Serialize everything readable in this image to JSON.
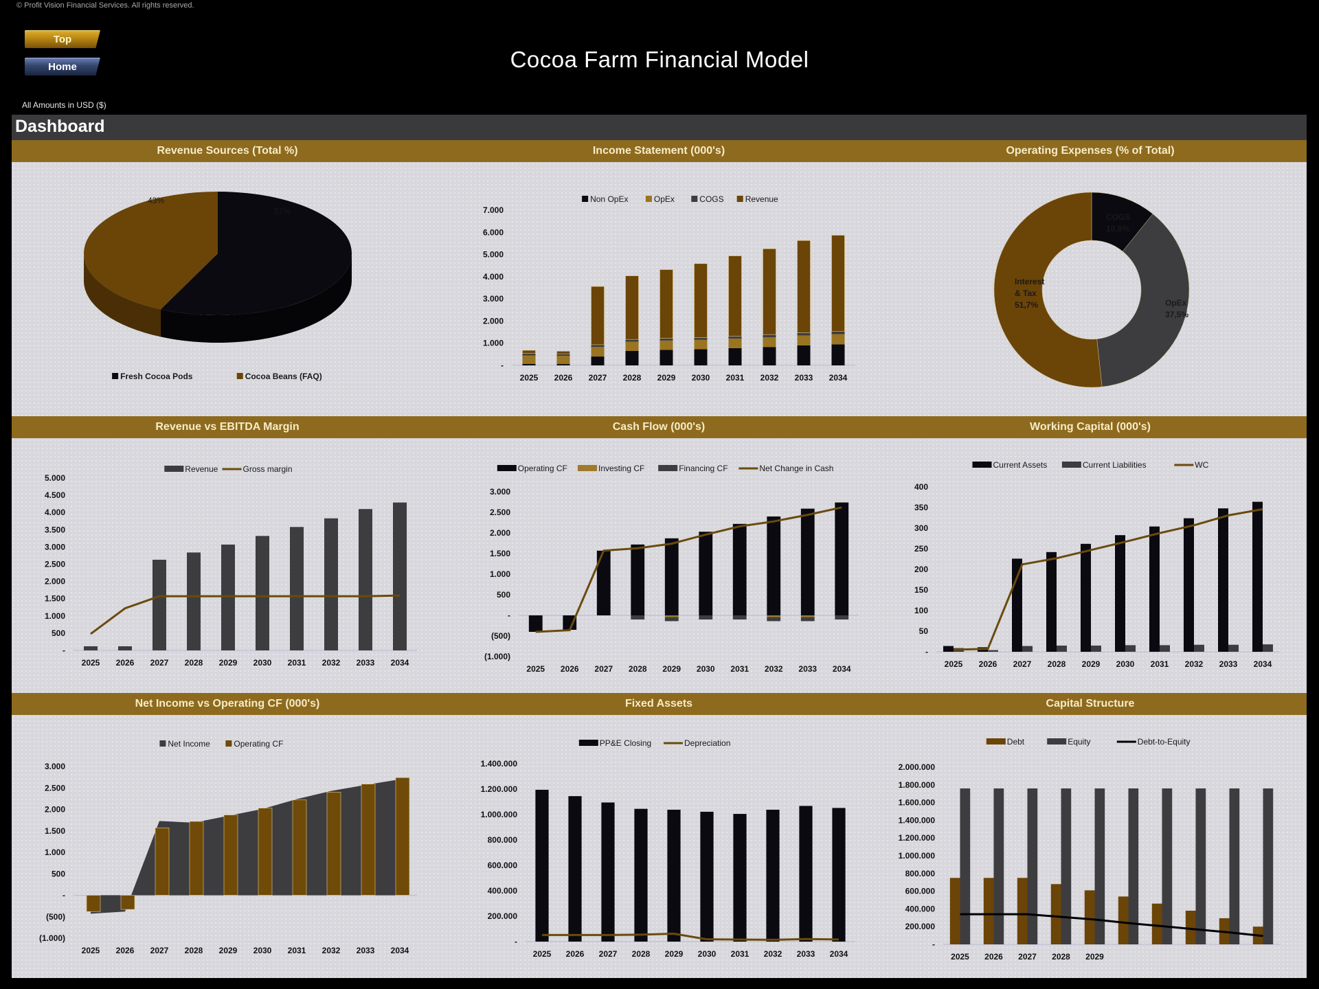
{
  "header": {
    "copyright": "© Profit Vision Financial Services. All rights reserved.",
    "title": "Cocoa Farm Financial Model",
    "amounts_note": "All Amounts in  USD ($)",
    "nav": {
      "top_label": "Top",
      "home_label": "Home"
    },
    "dashboard_label": "Dashboard"
  },
  "colors": {
    "gold_band": "#8e6a1e",
    "brown": "#6b4408",
    "dark": "#0a0a10",
    "gray": "#3d3d40",
    "tan": "#9a7420",
    "panel": "#d7d7dc"
  },
  "sections": {
    "row1": [
      "Revenue Sources (Total %)",
      "Income Statement (000's)",
      "Operating Expenses (% of Total)"
    ],
    "row2": [
      "Revenue vs EBITDA Margin",
      "Cash Flow (000's)",
      "Working Capital (000's)"
    ],
    "row3": [
      "Net Income vs Operating CF (000's)",
      "Fixed Assets",
      "Capital Structure"
    ]
  },
  "chart_data": [
    {
      "id": "revenue_sources",
      "type": "pie",
      "title": "Revenue Sources (Total %)",
      "labels": [
        "Fresh Cocoa Pods",
        "Cocoa Beans (FAQ)"
      ],
      "values": [
        57,
        43
      ],
      "value_labels": [
        "57%",
        "43%"
      ],
      "legend": "bottom"
    },
    {
      "id": "income_statement",
      "type": "bar",
      "stacked": true,
      "title": "Income Statement (000's)",
      "categories": [
        "2025",
        "2026",
        "2027",
        "2028",
        "2029",
        "2030",
        "2031",
        "2032",
        "2033",
        "2034"
      ],
      "series": [
        {
          "name": "Non OpEx",
          "values": [
            70,
            60,
            400,
            650,
            700,
            730,
            780,
            830,
            900,
            950
          ]
        },
        {
          "name": "OpEx",
          "values": [
            380,
            370,
            430,
            420,
            420,
            420,
            430,
            440,
            450,
            460
          ]
        },
        {
          "name": "COGS",
          "values": [
            90,
            90,
            100,
            100,
            100,
            100,
            110,
            120,
            120,
            130
          ]
        },
        {
          "name": "Revenue",
          "values": [
            140,
            120,
            2630,
            2870,
            3100,
            3340,
            3620,
            3870,
            4160,
            4330
          ]
        }
      ],
      "ylim": [
        0,
        7000
      ],
      "yticks": [
        "-",
        "1.000",
        "2.000",
        "3.000",
        "4.000",
        "5.000",
        "6.000",
        "7.000"
      ],
      "legend": "top"
    },
    {
      "id": "operating_expenses",
      "type": "pie",
      "donut": true,
      "title": "Operating Expenses (% of Total)",
      "labels": [
        "COGS",
        "OpEx",
        "Interest & Tax"
      ],
      "values": [
        10.8,
        37.5,
        51.7
      ],
      "value_labels": [
        "10,8%",
        "37,5%",
        "51,7%"
      ],
      "label_lines": [
        [
          "COGS",
          "10,8%"
        ],
        [
          "OpEx",
          "37,5%"
        ],
        [
          "Interest",
          "& Tax",
          "51,7%"
        ]
      ]
    },
    {
      "id": "revenue_vs_ebitda",
      "type": "bar",
      "title": "Revenue vs EBITDA Margin",
      "categories": [
        "2025",
        "2026",
        "2027",
        "2028",
        "2029",
        "2030",
        "2031",
        "2032",
        "2033",
        "2034"
      ],
      "series": [
        {
          "name": "Revenue",
          "kind": "bar",
          "values": [
            120,
            120,
            2630,
            2840,
            3070,
            3320,
            3580,
            3830,
            4100,
            4290
          ]
        },
        {
          "name": "Gross margin",
          "kind": "line",
          "values": [
            480,
            1220,
            1570,
            1570,
            1570,
            1570,
            1570,
            1570,
            1570,
            1590
          ]
        }
      ],
      "ylim": [
        0,
        5000
      ],
      "yticks": [
        "-",
        "500",
        "1.000",
        "1.500",
        "2.000",
        "2.500",
        "3.000",
        "3.500",
        "4.000",
        "4.500",
        "5.000"
      ],
      "legend": "top"
    },
    {
      "id": "cash_flow",
      "type": "bar",
      "stacked": true,
      "title": "Cash Flow (000's)",
      "categories": [
        "2025",
        "2026",
        "2027",
        "2028",
        "2029",
        "2030",
        "2031",
        "2032",
        "2033",
        "2034"
      ],
      "series": [
        {
          "name": "Operating CF",
          "kind": "bar",
          "values": [
            -400,
            -350,
            1570,
            1720,
            1870,
            2030,
            2220,
            2400,
            2590,
            2740
          ]
        },
        {
          "name": "Investing CF",
          "kind": "bar",
          "values": [
            0,
            0,
            0,
            0,
            -40,
            0,
            0,
            -40,
            -40,
            0
          ]
        },
        {
          "name": "Financing CF",
          "kind": "bar",
          "values": [
            0,
            0,
            0,
            -100,
            -100,
            -100,
            -100,
            -100,
            -100,
            -100
          ]
        },
        {
          "name": "Net Change in Cash",
          "kind": "line",
          "values": [
            -400,
            -360,
            1570,
            1630,
            1740,
            1960,
            2160,
            2280,
            2440,
            2620
          ]
        }
      ],
      "ylim": [
        -1000,
        3000
      ],
      "yticks": [
        "(1.000)",
        "(500)",
        "-",
        "500",
        "1.000",
        "1.500",
        "2.000",
        "2.500",
        "3.000"
      ],
      "legend": "top"
    },
    {
      "id": "working_capital",
      "type": "bar",
      "title": "Working Capital (000's)",
      "categories": [
        "2025",
        "2026",
        "2027",
        "2028",
        "2029",
        "2030",
        "2031",
        "2032",
        "2033",
        "2034"
      ],
      "series": [
        {
          "name": "Current Assets",
          "kind": "bar",
          "values": [
            14,
            11,
            226,
            242,
            262,
            283,
            304,
            324,
            348,
            364
          ]
        },
        {
          "name": "Current Liabilities",
          "kind": "bar",
          "values": [
            9,
            4,
            14,
            15,
            15,
            16,
            16,
            17,
            17,
            18
          ]
        },
        {
          "name": "WC",
          "kind": "line",
          "values": [
            5,
            7,
            212,
            227,
            247,
            267,
            288,
            307,
            331,
            346
          ]
        }
      ],
      "ylim": [
        0,
        400
      ],
      "yticks": [
        "-",
        "50",
        "100",
        "150",
        "200",
        "250",
        "300",
        "350",
        "400"
      ],
      "legend": "top"
    },
    {
      "id": "net_income_vs_ocf",
      "type": "area",
      "title": "Net Income vs Operating CF (000's)",
      "categories": [
        "2025",
        "2026",
        "2027",
        "2028",
        "2029",
        "2030",
        "2031",
        "2032",
        "2033",
        "2034"
      ],
      "series": [
        {
          "name": "Net Income",
          "kind": "area",
          "values": [
            -430,
            -380,
            1730,
            1690,
            1850,
            2010,
            2240,
            2430,
            2570,
            2700
          ]
        },
        {
          "name": "Operating CF",
          "kind": "bar",
          "values": [
            -380,
            -330,
            1570,
            1720,
            1870,
            2030,
            2220,
            2400,
            2590,
            2740
          ]
        }
      ],
      "ylim": [
        -1000,
        3000
      ],
      "yticks": [
        "(1.000)",
        "(500)",
        "-",
        "500",
        "1.000",
        "1.500",
        "2.000",
        "2.500",
        "3.000"
      ],
      "legend": "top"
    },
    {
      "id": "fixed_assets",
      "type": "bar",
      "title": "Fixed Assets",
      "categories": [
        "2025",
        "2026",
        "2027",
        "2028",
        "2029",
        "2030",
        "2031",
        "2032",
        "2033",
        "2034"
      ],
      "series": [
        {
          "name": "PP&E Closing",
          "kind": "bar",
          "values": [
            1195000,
            1145000,
            1095000,
            1045000,
            1038000,
            1022000,
            1005000,
            1038000,
            1068000,
            1052000
          ]
        },
        {
          "name": "Depreciation",
          "kind": "line",
          "values": [
            52000,
            52000,
            52000,
            55000,
            62000,
            18000,
            16000,
            14000,
            20000,
            17000
          ]
        }
      ],
      "ylim": [
        0,
        1400000
      ],
      "yticks": [
        "-",
        "200.000",
        "400.000",
        "600.000",
        "800.000",
        "1.000.000",
        "1.200.000",
        "1.400.000"
      ],
      "legend": "top"
    },
    {
      "id": "capital_structure",
      "type": "bar",
      "title": "Capital Structure",
      "categories": [
        "2025",
        "2026",
        "2027",
        "2028",
        "2029",
        "",
        "",
        "",
        "",
        ""
      ],
      "series": [
        {
          "name": "Debt",
          "kind": "bar",
          "values": [
            750000,
            750000,
            750000,
            680000,
            610000,
            540000,
            460000,
            380000,
            295000,
            200000
          ]
        },
        {
          "name": "Equity",
          "kind": "bar",
          "values": [
            1760000,
            1760000,
            1760000,
            1760000,
            1760000,
            1760000,
            1760000,
            1760000,
            1760000,
            1760000
          ]
        },
        {
          "name": "Debt-to-Equity",
          "kind": "line",
          "values": [
            340000,
            340000,
            340000,
            310000,
            280000,
            240000,
            205000,
            170000,
            135000,
            95000
          ]
        }
      ],
      "ylim": [
        0,
        2000000
      ],
      "yticks": [
        "-",
        "200.000",
        "400.000",
        "600.000",
        "800.000",
        "1.000.000",
        "1.200.000",
        "1.400.000",
        "1.600.000",
        "1.800.000",
        "2.000.000"
      ],
      "legend": "top"
    }
  ]
}
